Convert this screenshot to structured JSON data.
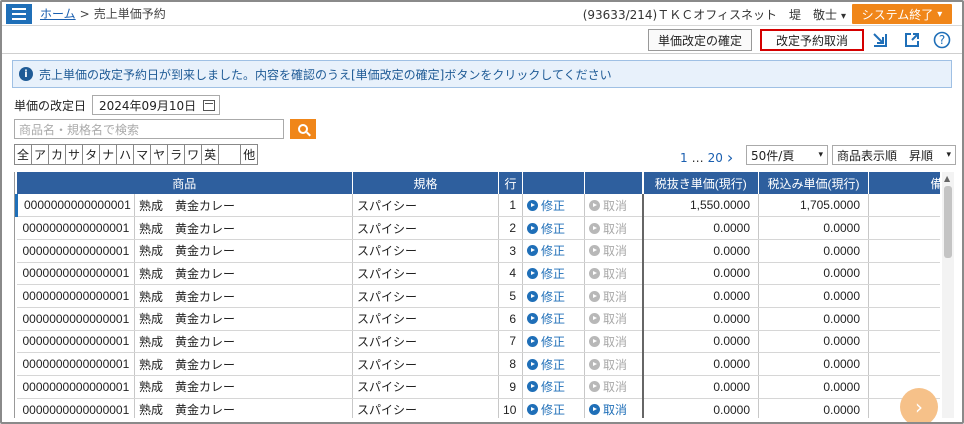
{
  "header": {
    "home_link": "ホーム",
    "separator": ">",
    "page_title": "売上単価予約",
    "user_info": "(93633/214)ＴＫＣオフィスネット　堤　敬士",
    "user_caret": "▾",
    "system_exit": "システム終了"
  },
  "toolbar": {
    "confirm_label": "単価改定の確定",
    "cancel_label": "改定予約取消",
    "export_icon": "export-icon",
    "open_window_icon": "open-window-icon",
    "help_icon": "help-icon",
    "help_glyph": "?"
  },
  "notice": {
    "icon": "i",
    "text": "売上単価の改定予約日が到来しました。内容を確認のうえ[単価改定の確定]ボタンをクリックしてください"
  },
  "date": {
    "label": "単価の改定日",
    "value": "2024年09月10日"
  },
  "search": {
    "placeholder": "商品名・規格名で検索"
  },
  "kana_filters": [
    "全",
    "ア",
    "カ",
    "サ",
    "タ",
    "ナ",
    "ハ",
    "マ",
    "ヤ",
    "ラ",
    "ワ",
    "英",
    "",
    "他"
  ],
  "pager": {
    "first": "1",
    "dots": "…",
    "last": "20",
    "next": "›",
    "per_page": "50件/頁",
    "sort": "商品表示順　昇順"
  },
  "table": {
    "headers": {
      "product": "商品",
      "spec": "規格",
      "row": "行",
      "price_ex": "税抜き単価(現行)",
      "price_in": "税込み単価(現行)",
      "note": "備考"
    },
    "edit_label": "修正",
    "cancel_label": "取消",
    "rows": [
      {
        "code": "0000000000000001",
        "name": "熟成　黄金カレー",
        "spec": "スパイシー",
        "row": "1",
        "cancel_enabled": false,
        "price_ex": "1,550.0000",
        "price_in": "1,705.0000"
      },
      {
        "code": "0000000000000001",
        "name": "熟成　黄金カレー",
        "spec": "スパイシー",
        "row": "2",
        "cancel_enabled": false,
        "price_ex": "0.0000",
        "price_in": "0.0000"
      },
      {
        "code": "0000000000000001",
        "name": "熟成　黄金カレー",
        "spec": "スパイシー",
        "row": "3",
        "cancel_enabled": false,
        "price_ex": "0.0000",
        "price_in": "0.0000"
      },
      {
        "code": "0000000000000001",
        "name": "熟成　黄金カレー",
        "spec": "スパイシー",
        "row": "4",
        "cancel_enabled": false,
        "price_ex": "0.0000",
        "price_in": "0.0000"
      },
      {
        "code": "0000000000000001",
        "name": "熟成　黄金カレー",
        "spec": "スパイシー",
        "row": "5",
        "cancel_enabled": false,
        "price_ex": "0.0000",
        "price_in": "0.0000"
      },
      {
        "code": "0000000000000001",
        "name": "熟成　黄金カレー",
        "spec": "スパイシー",
        "row": "6",
        "cancel_enabled": false,
        "price_ex": "0.0000",
        "price_in": "0.0000"
      },
      {
        "code": "0000000000000001",
        "name": "熟成　黄金カレー",
        "spec": "スパイシー",
        "row": "7",
        "cancel_enabled": false,
        "price_ex": "0.0000",
        "price_in": "0.0000"
      },
      {
        "code": "0000000000000001",
        "name": "熟成　黄金カレー",
        "spec": "スパイシー",
        "row": "8",
        "cancel_enabled": false,
        "price_ex": "0.0000",
        "price_in": "0.0000"
      },
      {
        "code": "0000000000000001",
        "name": "熟成　黄金カレー",
        "spec": "スパイシー",
        "row": "9",
        "cancel_enabled": false,
        "price_ex": "0.0000",
        "price_in": "0.0000"
      },
      {
        "code": "0000000000000001",
        "name": "熟成　黄金カレー",
        "spec": "スパイシー",
        "row": "10",
        "cancel_enabled": true,
        "price_ex": "0.0000",
        "price_in": "0.0000"
      }
    ]
  },
  "colors": {
    "accent": "#1f6fb8",
    "header_bg": "#2e5f9e",
    "orange": "#f08619",
    "highlight_border": "#d40000"
  }
}
